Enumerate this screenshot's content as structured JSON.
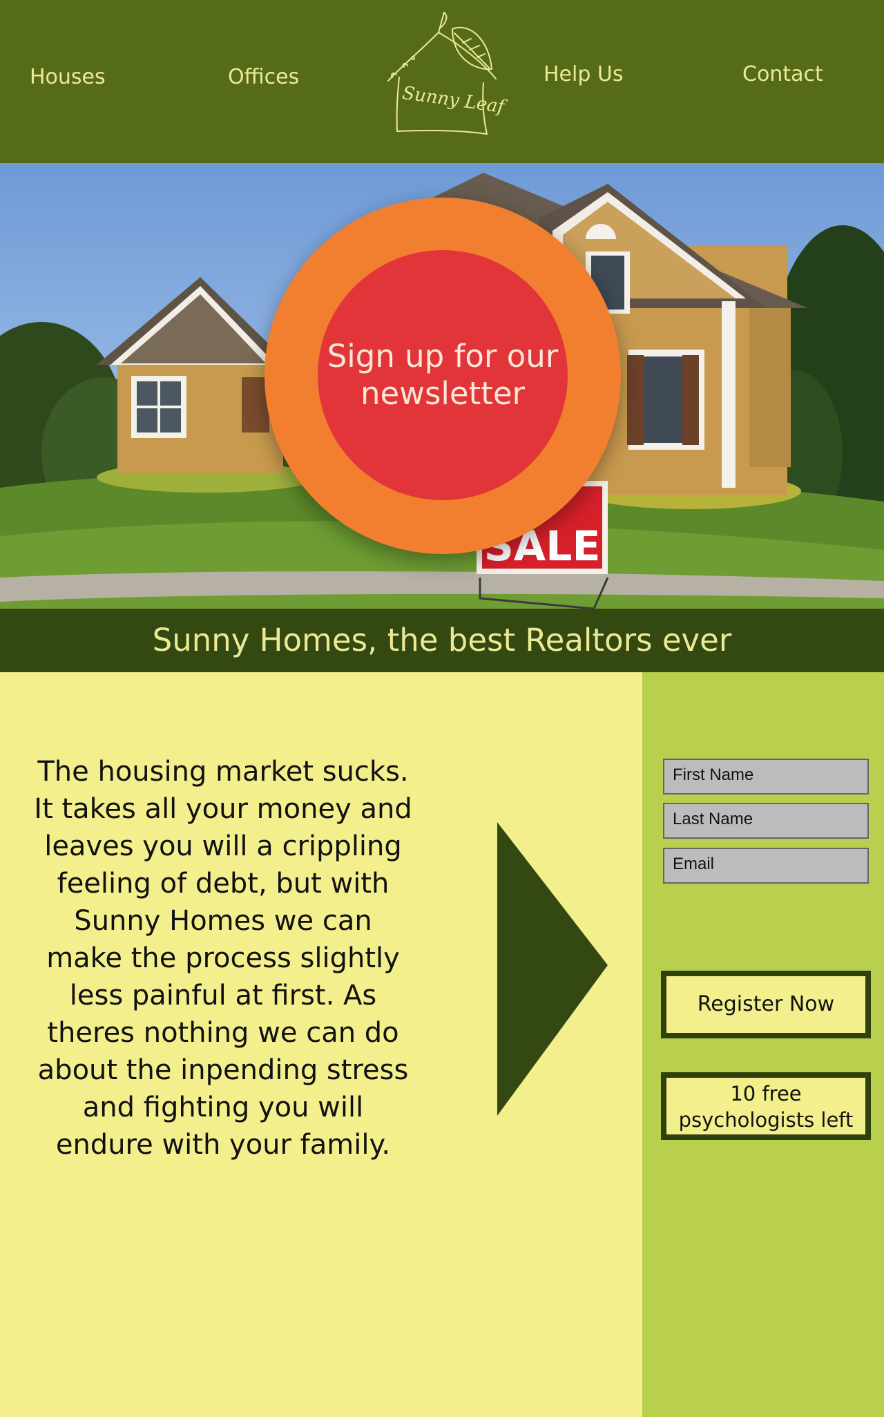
{
  "nav": {
    "houses": "Houses",
    "offices": "Offices",
    "help": "Help Us",
    "contact": "Contact"
  },
  "logo": {
    "text": "Sunny Leaf"
  },
  "hero": {
    "newsletter": "Sign up for our newsletter",
    "sign_text": "R\nSALE"
  },
  "tagline": "Sunny Homes, the best Realtors ever",
  "intro": "The housing market sucks. It takes all your money and leaves you will a crippling feeling of debt, but with Sunny Homes we can make the process slightly less painful at first. As theres nothing we can do about the inpending stress and fighting you will endure with your family.",
  "form": {
    "first_name": "First Name",
    "last_name": "Last Name",
    "email": "Email",
    "register": "Register Now",
    "psychologists": "10 free psychologists left"
  },
  "colors": {
    "header": "#566b18",
    "tagline_bar": "#344811",
    "page_bg": "#f3ef8c",
    "sidebar": "#b9d04f",
    "ring": "#f27f30",
    "circle": "#e1353a"
  }
}
